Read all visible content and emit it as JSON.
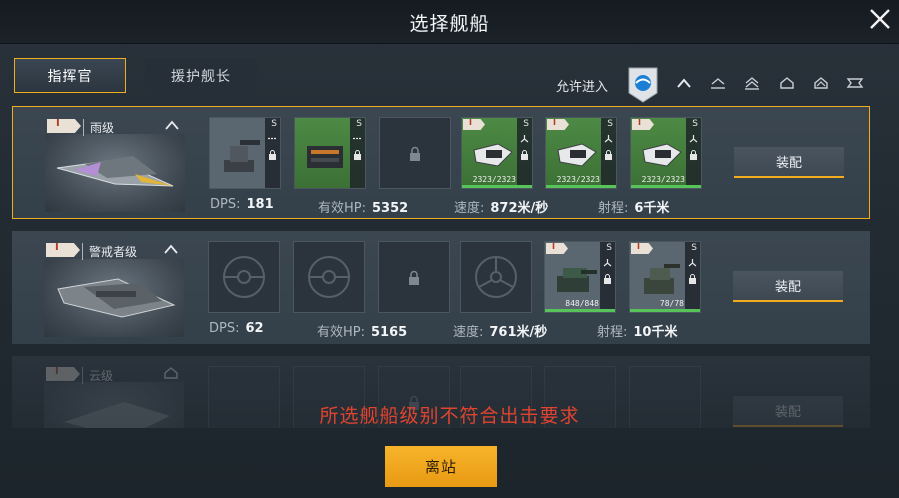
{
  "header": {
    "title": "选择舰船"
  },
  "tabs": [
    {
      "label": "指挥官",
      "active": true
    },
    {
      "label": "援护舰长",
      "active": false
    }
  ],
  "filter": {
    "label": "允许进入"
  },
  "ships": [
    {
      "tier": "I",
      "name": "雨级",
      "selected": true,
      "slots": [
        {
          "state": "filled",
          "s": "S",
          "item": "turret-icon"
        },
        {
          "state": "filled",
          "s": "S",
          "item": "launcher-icon"
        },
        {
          "state": "locked"
        },
        {
          "state": "green",
          "s": "S",
          "tier": "I",
          "hp": "2323/2323",
          "hp_fraction": 1.0
        },
        {
          "state": "green",
          "s": "S",
          "tier": "I",
          "hp": "2323/2323",
          "hp_fraction": 1.0
        },
        {
          "state": "green",
          "s": "S",
          "tier": "I",
          "hp": "2323/2323",
          "hp_fraction": 1.0
        }
      ],
      "stats": {
        "dps_label": "DPS:",
        "dps": "181",
        "hp_label": "有效HP:",
        "hp": "5352",
        "speed_label": "速度:",
        "speed": "872米/秒",
        "range_label": "射程:",
        "range": "6千米"
      },
      "equip_label": "装配"
    },
    {
      "tier": "I",
      "name": "警戒者级",
      "selected": false,
      "slots": [
        {
          "state": "empty"
        },
        {
          "state": "empty"
        },
        {
          "state": "locked"
        },
        {
          "state": "empty-alt"
        },
        {
          "state": "filled",
          "s": "S",
          "tier": "I",
          "hp": "848/848",
          "hp_fraction": 1.0
        },
        {
          "state": "filled",
          "s": "S",
          "tier": "I",
          "hp": "78/78",
          "hp_fraction": 1.0
        }
      ],
      "stats": {
        "dps_label": "DPS:",
        "dps": "62",
        "hp_label": "有效HP:",
        "hp": "5165",
        "speed_label": "速度:",
        "speed": "761米/秒",
        "range_label": "射程:",
        "range": "10千米"
      },
      "equip_label": "装配"
    },
    {
      "tier": "I",
      "name": "云级",
      "selected": false,
      "disabled": true,
      "equip_label": "装配"
    }
  ],
  "warning": "所选舰船级别不符合出击要求",
  "leave_button": "离站",
  "colors": {
    "accent": "#f2ad1f",
    "warning": "#e0442f",
    "slot_green": "#4d8a45"
  }
}
